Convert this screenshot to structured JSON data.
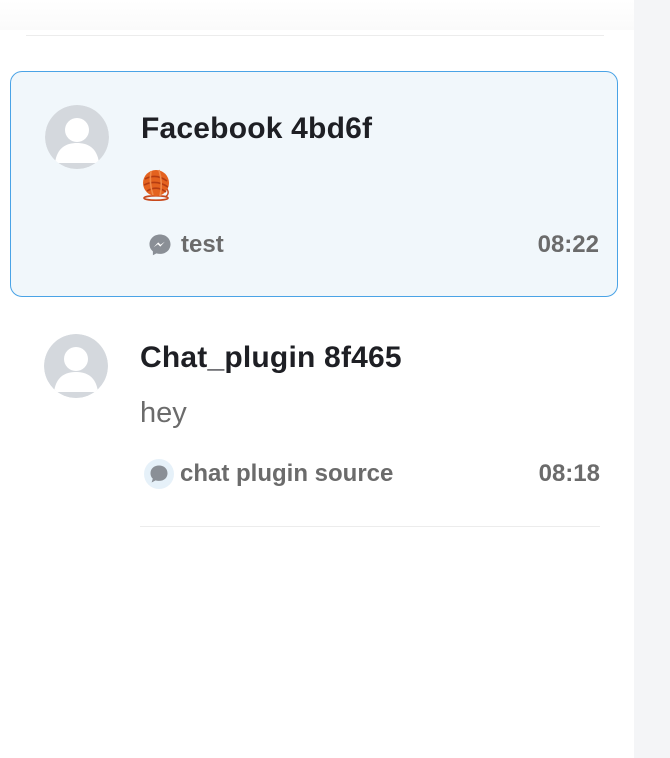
{
  "conversations": [
    {
      "name": "Facebook 4bd6f",
      "message_emoji": "yarn-ball-emoji",
      "source": {
        "label": "test",
        "icon": "messenger-icon"
      },
      "time": "08:22",
      "selected": true
    },
    {
      "name": "Chat_plugin 8f465",
      "message": "hey",
      "source": {
        "label": "chat plugin source",
        "icon": "chat-bubble-icon"
      },
      "time": "08:18",
      "selected": false
    }
  ],
  "colors": {
    "selected_background": "#f1f7fb",
    "selected_border": "#4aa3e6",
    "name_text": "#1e1f24",
    "secondary_text": "#6b6b6b",
    "avatar_placeholder": "#d4d8dd",
    "right_strip": "#f4f5f7"
  }
}
